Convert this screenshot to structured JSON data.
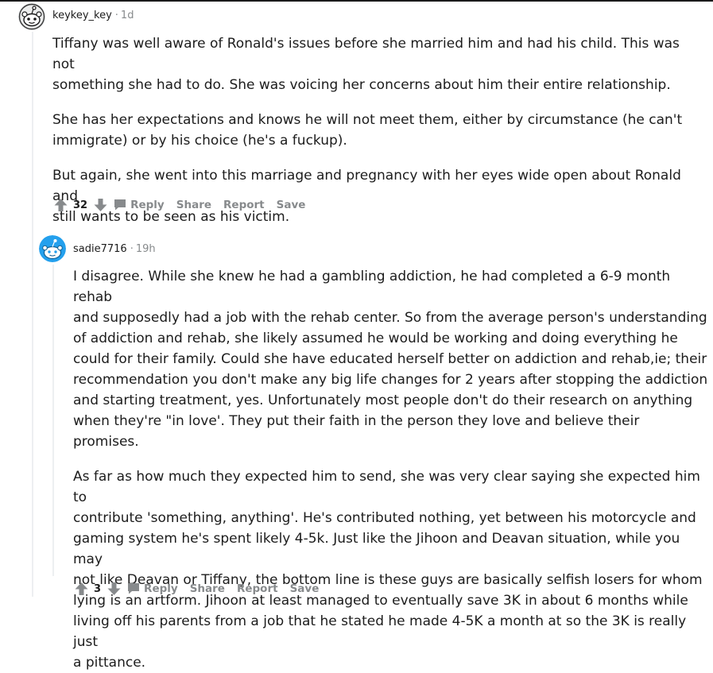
{
  "comments": [
    {
      "author": "keykey_key",
      "separator": "·",
      "time": "1d",
      "paragraphs": [
        "Tiffany was well aware of Ronald's issues before she married him and had his child. This was not\nsomething she had to do. She was voicing her concerns about him their entire relationship.",
        "She has her expectations and knows he will not meet them, either by circumstance (he can't\nimmigrate) or by his choice (he's a fuckup).",
        "But again, she went into this marriage and pregnancy with her eyes wide open about Ronald and\nstill wants to be seen as his victim."
      ],
      "score": "32",
      "actions": {
        "reply": "Reply",
        "share": "Share",
        "report": "Report",
        "save": "Save"
      }
    },
    {
      "author": "sadie7716",
      "separator": "·",
      "time": "19h",
      "paragraphs": [
        "I disagree. While she knew he had a gambling addiction, he had completed a 6-9 month rehab\nand supposedly had a job with the rehab center. So from the average person's understanding\nof addiction and rehab, she likely assumed he would be working and doing everything he\ncould for their family. Could she have educated herself better on addiction and rehab,ie; their\nrecommendation you don't make any big life changes for 2 years after stopping the addiction\nand starting treatment, yes. Unfortunately most people don't do their research on anything\nwhen they're \"in love'. They put their faith in the person they love and believe their promises.",
        "As far as how much they expected him to send, she was very clear saying she expected him to\ncontribute 'something, anything'. He's contributed nothing, yet between his motorcycle and\ngaming system he's spent likely 4-5k. Just like the Jihoon and Deavan situation, while you may\nnot like Deavan or Tiffany, the bottom line is these guys are basically selfish losers for whom\nlying is an artform. Jihoon at least managed to eventually save 3K in about 6 months while\nliving off his parents from a job that he stated he made 4-5K a month at so the 3K is really just\na pittance."
      ],
      "score": "3",
      "actions": {
        "reply": "Reply",
        "share": "Share",
        "report": "Report",
        "save": "Save"
      }
    }
  ],
  "colors": {
    "text": "#1c1c1c",
    "meta": "#878a8c",
    "thread_line": "#edeff1",
    "snoo_blue": "#24a0ed"
  },
  "icons": [
    "user-avatar-icon",
    "upvote-arrow-icon",
    "downvote-arrow-icon",
    "comment-bubble-icon"
  ]
}
